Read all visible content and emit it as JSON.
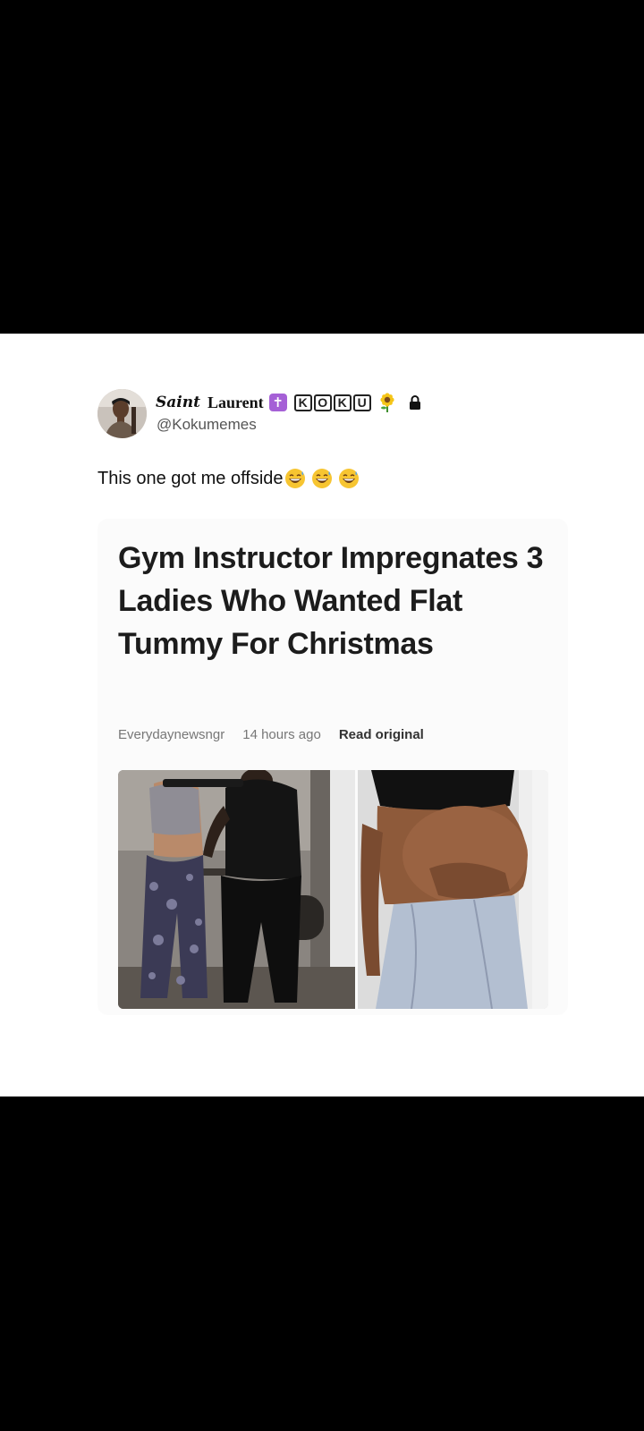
{
  "tweet": {
    "author": {
      "name_styled": "Saint",
      "name_rest": "Laurent",
      "cross_glyph": "✝",
      "badge_letters": [
        "K",
        "O",
        "K",
        "U"
      ],
      "handle": "@Kokumemes",
      "icons": [
        "latin-cross-emoji",
        "sunflower-emoji",
        "lock-icon"
      ]
    },
    "text": "This one got me offside",
    "emojis": [
      "grinning-sweat-emoji",
      "grinning-sweat-emoji",
      "grinning-sweat-emoji"
    ]
  },
  "article": {
    "headline": "Gym Instructor Impregnates 3 Ladies Who Wanted Flat Tummy For Christmas",
    "source": "Everydaynewsngr",
    "time": "14 hours ago",
    "read_label": "Read original",
    "images": [
      "gym-training-photo",
      "pregnant-belly-photo"
    ]
  },
  "colors": {
    "background": "#000000",
    "card": "#ffffff",
    "headline": "#1c1c1c",
    "cross_badge": "#a560d6"
  }
}
